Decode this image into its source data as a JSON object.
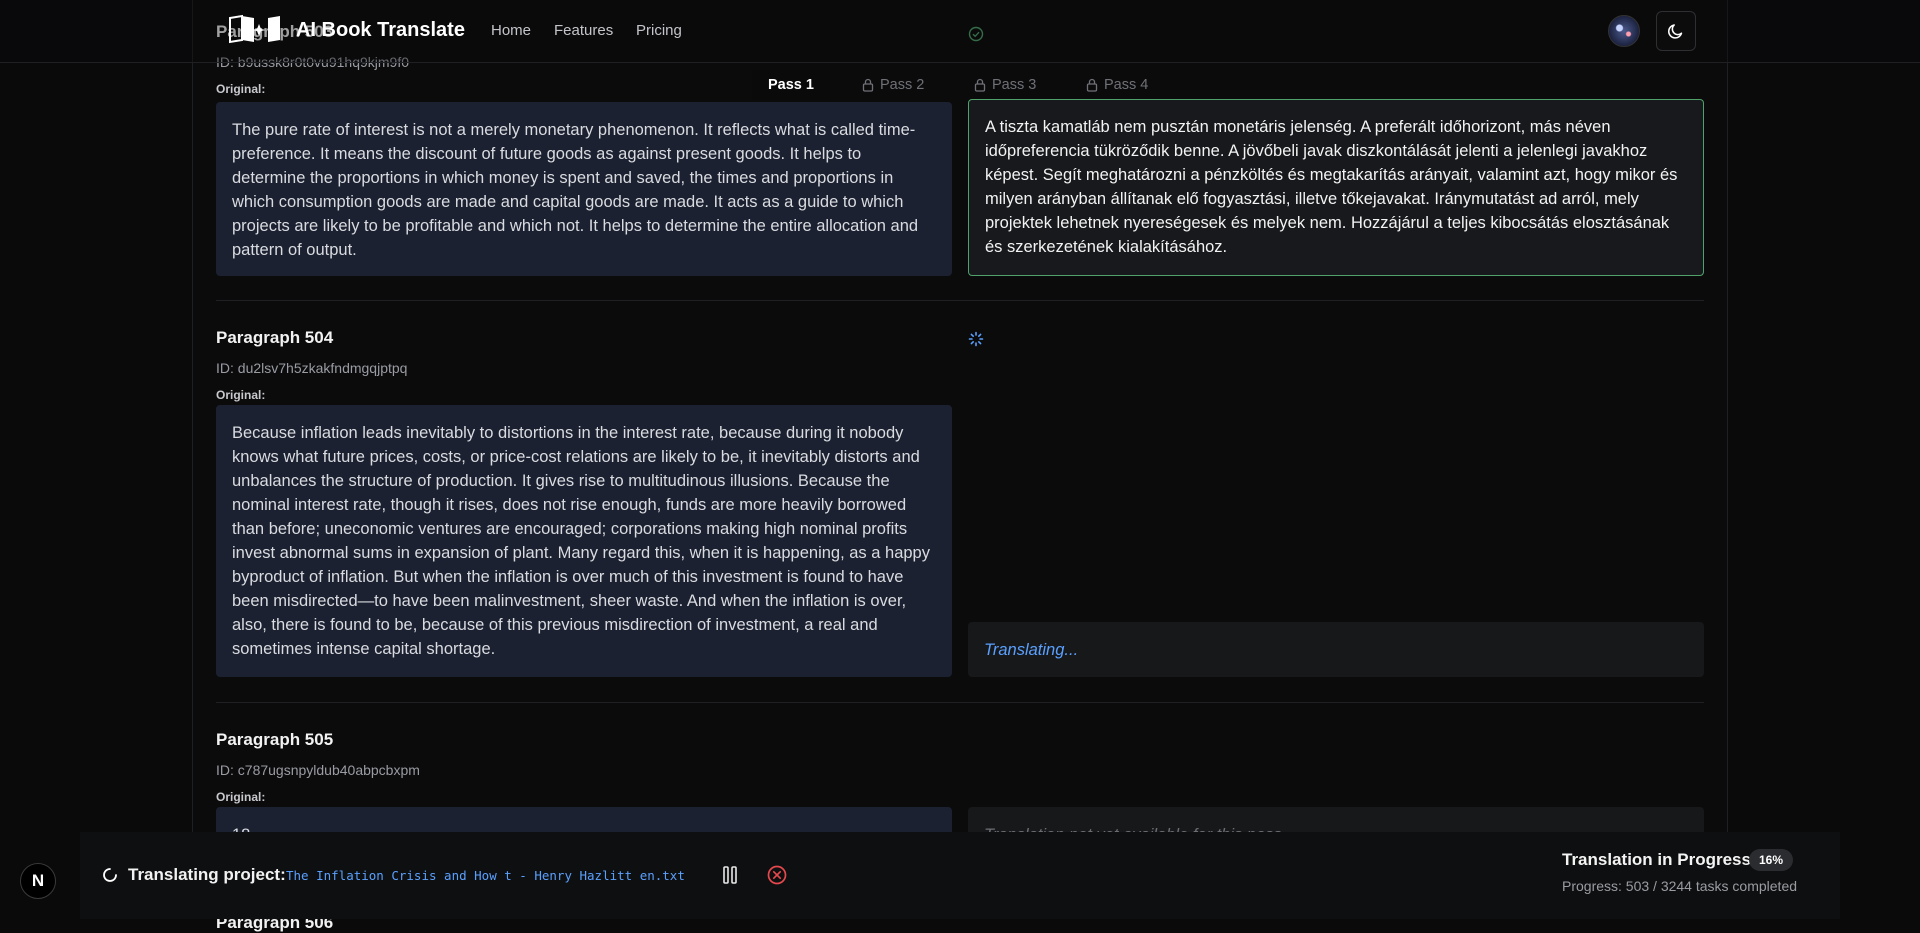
{
  "app": {
    "brand": "AI Book Translate",
    "nav": [
      "Home",
      "Features",
      "Pricing"
    ]
  },
  "passes": [
    {
      "label": "Pass 1",
      "active": true
    },
    {
      "label": "Pass 2",
      "locked": true
    },
    {
      "label": "Pass 3",
      "locked": true
    },
    {
      "label": "Pass 4",
      "locked": true
    }
  ],
  "paragraphs": [
    {
      "title": "Paragraph 503",
      "id": "ID: b9ussk8r0t0vu91hq9kjm9f0",
      "original_label": "Original:",
      "original": "The pure rate of interest is not a merely monetary phenomenon. It reflects what is called time-preference. It means the discount of future goods as against present goods. It helps to determine the proportions in which money is spent and saved, the times and proportions in which consumption goods are made and capital goods are made. It acts as a guide to which projects are likely to be profitable and which not. It helps to determine the entire allocation and pattern of output.",
      "translation": "A tiszta kamatláb nem pusztán monetáris jelenség. A preferált időhorizont, más néven időpreferencia tükröződik benne. A jövőbeli javak diszkontálását jelenti a jelenlegi javakhoz képest. Segít meghatározni a pénzköltés és megtakarítás arányait, valamint azt, hogy mikor és milyen arányban állítanak elő fogyasztási, illetve tőkejavakat. Iránymutatást ad arról, mely projektek lehetnek nyereségesek és melyek nem. Hozzájárul a teljes kibocsátás elosztásának és szerkezetének kialakításához.",
      "status": "done"
    },
    {
      "title": "Paragraph 504",
      "id": "ID: du2lsv7h5zkakfndmgqjptpq",
      "original_label": "Original:",
      "original": "Because inflation leads inevitably to distortions in the interest rate, because during it nobody knows what future prices, costs, or price-cost relations are likely to be, it inevitably distorts and unbalances the structure of production. It gives rise to multitudinous illusions. Because the nominal interest rate, though it rises, does not rise enough, funds are more heavily borrowed than before; uneconomic ventures are encouraged; corporations making high nominal profits invest abnormal sums in expansion of plant. Many regard this, when it is happening, as a happy byproduct of inflation. But when the inflation is over much of this investment is found to have been misdirected—to have been malinvestment, sheer waste. And when the inflation is over, also, there is found to be, because of this previous misdirection of investment, a real and sometimes intense capital shortage.",
      "translation": "Translating...",
      "status": "translating"
    },
    {
      "title": "Paragraph 505",
      "id": "ID: c787ugsnpyldub40abpcbxpm",
      "original_label": "Original:",
      "original": "18",
      "translation": "Translation not yet available for this pass",
      "status": "pending"
    },
    {
      "title": "Paragraph 506"
    }
  ],
  "project": {
    "label": "Translating project:",
    "name": "The Inflation Crisis and How t - Henry Hazlitt en.txt"
  },
  "progress_toast": {
    "title": "Translation in Progress",
    "percent": "16%",
    "progress_text": "Progress: 503 / 3244 tasks completed",
    "percent_value": 16,
    "tasks_done": 503,
    "tasks_total": 3244
  },
  "badge": {
    "letter": "N"
  },
  "colors": {
    "accent": "#5aa0ff",
    "success": "#4fa36a",
    "danger": "#e5484d",
    "original_bg": "#1b2130"
  },
  "icons": [
    "logo-icon",
    "check-circle-icon",
    "spinner-icon",
    "lock-icon",
    "moon-icon",
    "pause-icon",
    "cancel-icon",
    "loader-icon"
  ]
}
